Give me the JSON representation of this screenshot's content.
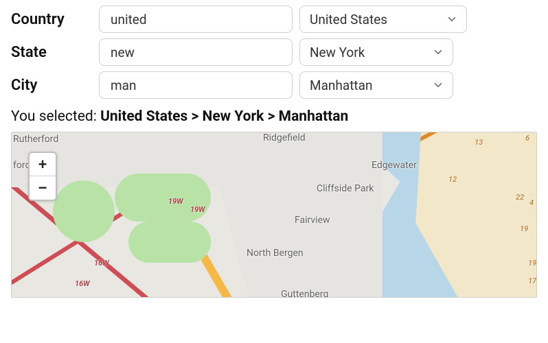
{
  "form": {
    "country": {
      "label": "Country",
      "input_value": "united",
      "selected": "United States"
    },
    "state": {
      "label": "State",
      "input_value": "new",
      "selected": "New York"
    },
    "city": {
      "label": "City",
      "input_value": "man",
      "selected": "Manhattan"
    }
  },
  "summary": {
    "prefix": "You selected: ",
    "path": "United States > New York > Manhattan"
  },
  "map": {
    "zoom_in": "+",
    "zoom_out": "−",
    "places": {
      "rutherford": "Rutherford",
      "ford": "ford",
      "ridgefield": "Ridgefield",
      "edgewater": "Edgewater",
      "cliffside_park": "Cliffside Park",
      "fairview": "Fairview",
      "north_bergen": "North Bergen",
      "guttenberg": "Guttenberg"
    },
    "shields": {
      "w19a": "19W",
      "w19b": "19W",
      "w16a": "16W",
      "w16b": "16W",
      "e13": "13",
      "e12": "12",
      "e22": "22",
      "e4": "4",
      "e19a": "19",
      "e19b": "19",
      "e17": "17",
      "e6": "6"
    }
  }
}
